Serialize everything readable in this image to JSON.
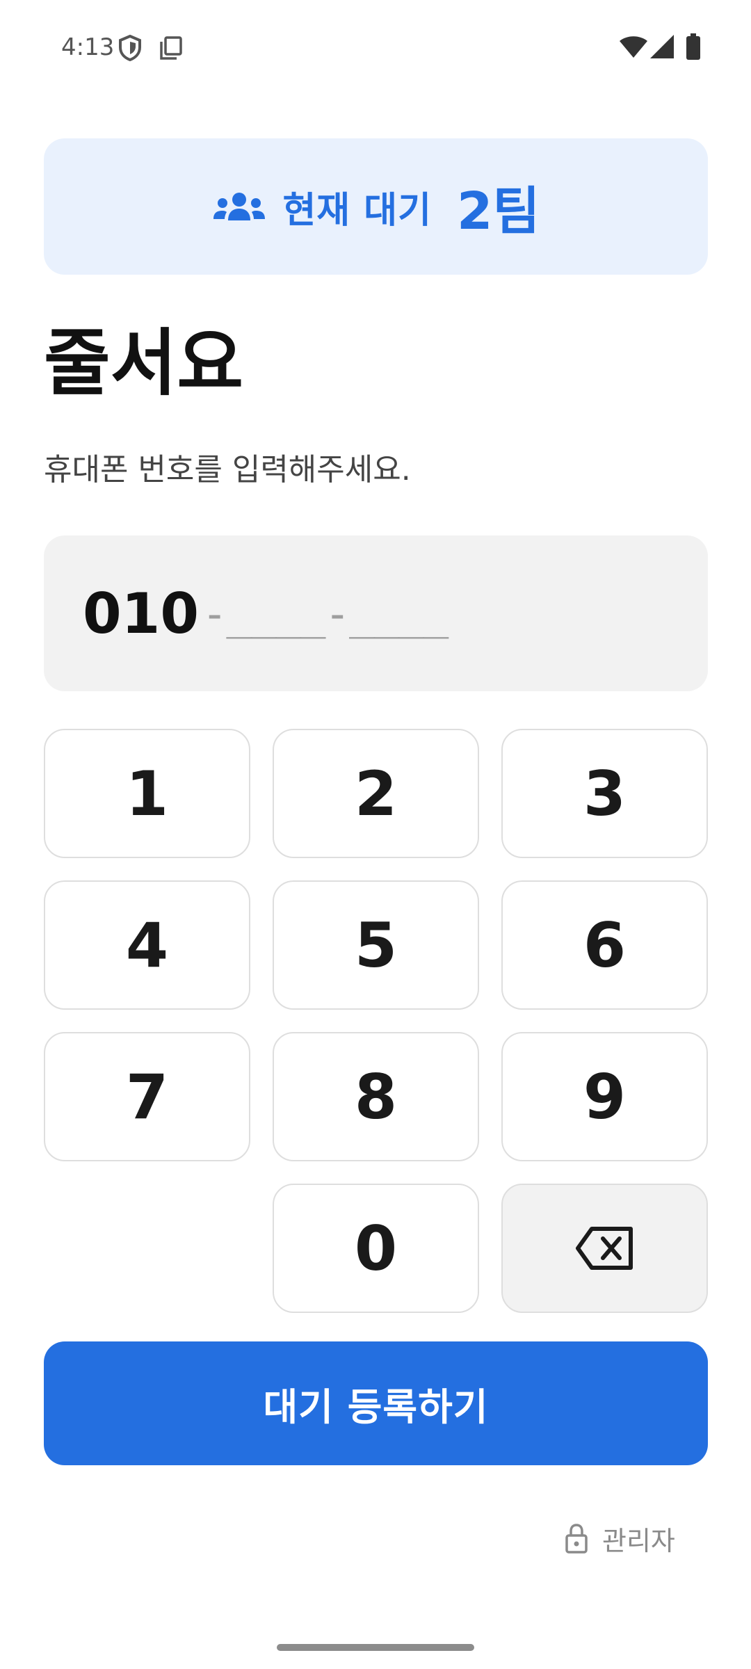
{
  "status_bar": {
    "time": "4:13",
    "icons": [
      "shield-icon",
      "copy-icon",
      "wifi-icon",
      "signal-icon",
      "battery-icon"
    ]
  },
  "waiting": {
    "label": "현재 대기",
    "count": "2팀",
    "icon": "people-icon",
    "color": "#246fe0",
    "background": "#e9f1fd"
  },
  "title": "줄서요",
  "subtitle": "휴대폰 번호를 입력해주세요.",
  "phone": {
    "prefix": "010",
    "rest": "-____-____"
  },
  "keypad": {
    "keys": [
      "1",
      "2",
      "3",
      "4",
      "5",
      "6",
      "7",
      "8",
      "9",
      "0"
    ],
    "backspace_icon": "backspace-icon"
  },
  "submit": {
    "label": "대기 등록하기",
    "color": "#246fe0"
  },
  "admin": {
    "label": "관리자",
    "icon": "lock-icon"
  }
}
